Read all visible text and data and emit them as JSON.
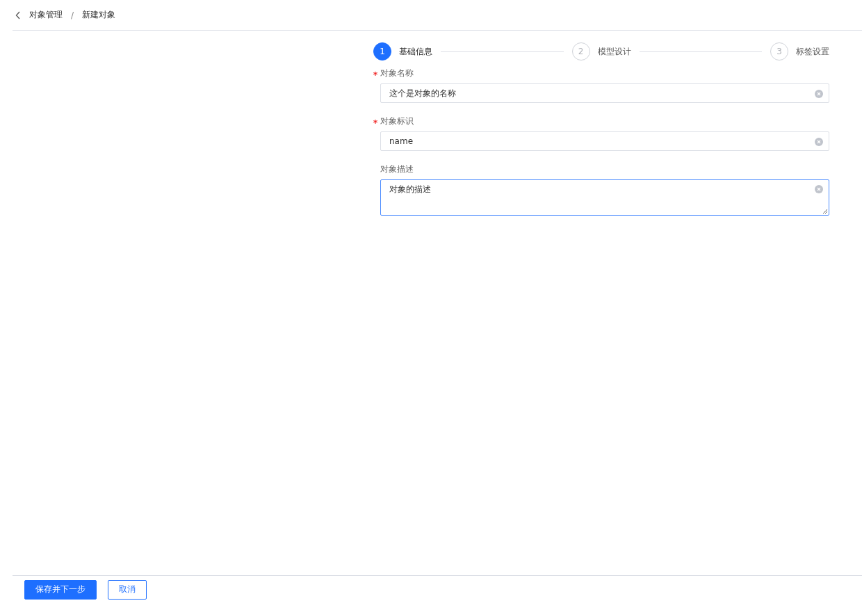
{
  "breadcrumb": {
    "items": [
      "对象管理",
      "新建对象"
    ],
    "separator": "/"
  },
  "steps": [
    {
      "number": "1",
      "label": "基础信息",
      "selected": true
    },
    {
      "number": "2",
      "label": "模型设计",
      "selected": false
    },
    {
      "number": "3",
      "label": "标签设置",
      "selected": false
    }
  ],
  "form": [
    {
      "label": "对象名称",
      "required": true,
      "kind": "input",
      "value": "这个是对象的名称",
      "focused": false
    },
    {
      "label": "对象标识",
      "required": true,
      "kind": "input",
      "value": "name",
      "focused": false
    },
    {
      "label": "对象描述",
      "required": false,
      "kind": "textarea",
      "value": "对象的描述",
      "focused": true
    }
  ],
  "footer": {
    "buttons": [
      {
        "label": "保存并下一步",
        "kind": "primary"
      },
      {
        "label": "取消",
        "kind": "secondary"
      }
    ]
  }
}
